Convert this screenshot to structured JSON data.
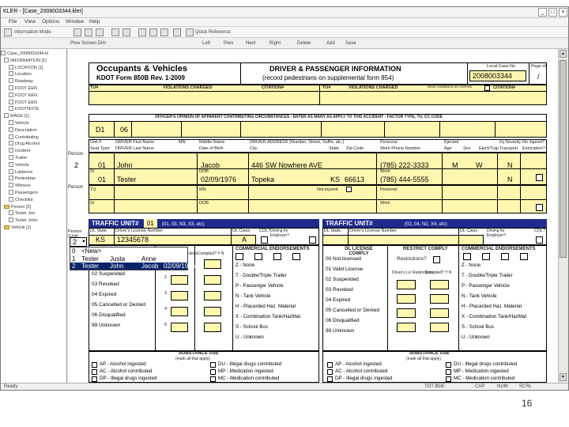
{
  "window": {
    "title": "KLER - [Case_2008003344.kler]",
    "min": "_",
    "max": "□",
    "close": "×"
  },
  "menu": [
    "File",
    "View",
    "Options",
    "Window",
    "Help"
  ],
  "toolbar1": {
    "a": "Information Mode",
    "b": "Quick Reference"
  },
  "toolbar2": {
    "a": "Prev Screen Dim",
    "b": "Left",
    "c": "Prev",
    "d": "Next",
    "e": "Right",
    "f": "Delete",
    "g": "Add",
    "h": "Save"
  },
  "tree": [
    "Case_2008003344.kl",
    "INFORMATION [1]",
    "LOCATION [1]",
    "Location",
    "Roadway",
    "FOOT EEN",
    "FOOT EEN",
    "FOOT EEN",
    "FOOTNOTE",
    "MAGE [1]",
    "Vehicle",
    "Description",
    "Contributing",
    "Drug Alcohol",
    "Incident",
    "Trailer",
    "Vehicle",
    "Lalderice",
    "Pedestrian",
    "Witness",
    "Passengers",
    "Checklist",
    "Person [2]",
    "Tester Joe",
    "Tester John",
    "Vehicle [1]"
  ],
  "form": {
    "title": "Occupants & Vehicles",
    "subtitle": "KDOT Form 850B Rev. 1-2009",
    "center_title": "DRIVER & PASSENGER INFORMATION",
    "center_sub": "(record pedestrians on supplemental form 854)",
    "case_label": "Local Case No",
    "case_no": "2008003344",
    "page_label": "Page of",
    "page_val": "/",
    "tu_label": "TU#",
    "violations_label": "VIOLATIONS CHARGED",
    "citation_label": "CITATION#",
    "tu2_label": "TU#",
    "violations2_label": "VIOLATIONS CHARGED",
    "more_viol": "More violations on reverse",
    "citation2_label": "CITATION#",
    "officer_opinion": "OFFICER'S OPINION OF APPARENT CONTRIBUTING CIRCUMSTANCES - ENTER AS MANY AS APPLY TO THIS ACCIDENT - FACTOR TYPE, TU, CC CODE",
    "d1": "D1",
    "d1_val": "06",
    "person_label": "Person",
    "hdr_unit": "Unit #",
    "hdr_seat": "Seat Type",
    "hdr_first": "DRIVER First Name",
    "hdr_last": "DRIVER Last Name",
    "hdr_mn": "MN",
    "hdr_middle": "Middle Name",
    "hdr_dob": "Date of Birth",
    "hdr_addr": "DRIVER ADDRESS (Number, Street, Suffix, etc.)",
    "hdr_city": "City",
    "hdr_state": "State",
    "hdr_zip": "Zip Code",
    "hdr_personal": "Personal",
    "hdr_phone": "Personal Phone Number",
    "hdr_work": "Work Phone Number",
    "hdr_ejected": "Ejected",
    "hdr_age": "Age",
    "hdr_sex": "Sex",
    "hdr_inj": "Inj Severity",
    "hdr_inj_type": "Eject/Trap",
    "hdr_transport": "Transport",
    "hdr_extrication": "Extrication?",
    "hdr_no_injured": "No injured?",
    "p1_num": "2",
    "p1_unit": "01",
    "p1_first": "John",
    "p1_middle": "Jacob",
    "p1_addr": "446 SW Nowhere AVE",
    "p1_phone": "(785) 222-3333",
    "p1_age": "M",
    "p1_sex": "W",
    "p1_inj": "N",
    "p1_si": "SI",
    "p1_unit2": "01",
    "p1_last": "Tester",
    "p1_dob_label": "DOB",
    "p1_dob": "02/09/1976",
    "p1_city": "Topeka",
    "p1_state": "KS",
    "p1_zip": "66613",
    "p1_work_label": "Work",
    "p1_work": "(785) 444-5555",
    "p1_w": "N",
    "p2_tu": "TU",
    "p2_mn": "MN",
    "p2_not_injured": "Not injured",
    "p2_personal": "Personal",
    "p2_si": "SI",
    "p2_dob": "DOB",
    "p2_work": "Work",
    "traffic_unit_label": "TRAFFIC UNIT#",
    "traffic_unit_val": "01",
    "traffic_unit_hint": "(01, 03, N3, X3, etc)",
    "traffic_unit2_label": "TRAFFIC UNIT#",
    "traffic_unit2_hint": "(02, 04, N2, X4, etc)",
    "person_unit": "Person (Unit)",
    "person_unit_val": "2",
    "dl_state": "DL State",
    "dl_num": "Driver's License Number",
    "dl_class": "DL Class",
    "cdl": "CDL?",
    "driving_for_employer": "Driving for Employer?",
    "dl_state_val": "KS",
    "dl_num_val": "12345678",
    "dl_class_val": "A",
    "dl_state2": "DL State",
    "dl_num2": "Driver's License Number",
    "dl_class2": "DL Class",
    "cdl2": "CDL?",
    "driving_for_employer2": "Driving for Employer?",
    "commercial_endorse": "COMMERCIAL ENDORSEMENTS",
    "dl_comply": "DL LICENSE COMPLY",
    "restrict_comply": "RESTRICT COMPLY",
    "commercial_endorse2": "COMMERCIAL ENDORSEMENTS",
    "restrictions": "Restrictions?",
    "driver_lic_restr": "Driver's Lic Restrictions",
    "complied": "Complied? Y N",
    "codes_left": [
      "01 Valid License",
      "02 Suspended",
      "03 Revoked",
      "04 Expired",
      "05 Cancelled or Denied",
      "06 Disqualified",
      "99 Unknown"
    ],
    "endorse_left": [
      "Z - None",
      "T - Double/Triple Trailer",
      "P - Passenger Vehicle",
      "N - Tank Vehicle",
      "H - Placarded Haz. Material",
      "X - Combination Tank/HazMat",
      "S - School Bus",
      "U - Unknown"
    ],
    "codes_right": [
      "00 Not licensed",
      "01 Valid License",
      "02 Suspended",
      "03 Revoked",
      "04 Expired",
      "05 Cancelled or Denied",
      "06 Disqualified",
      "99 Unknown"
    ],
    "endorse_right": [
      "Z - None",
      "T - Double/Triple Trailer",
      "P - Passenger Vehicle",
      "N - Tank Vehicle",
      "H - Placarded Haz. Material",
      "X - Combination Tank/HazMat",
      "S - School Bus",
      "U - Unknown"
    ],
    "restr_nums": [
      "1",
      "2",
      "3",
      "4",
      "5"
    ],
    "substance_use": "SUBSTANCE USE",
    "substance_sub": "(mark all that apply)",
    "subst_left": [
      "AP - Alcohol ingested",
      "AC - Alcohol contributed",
      "DP - Illegal drugs ingested"
    ],
    "subst_mid": [
      "DU - Illegal drugs contributed",
      "MP - Medication ingested",
      "MC - Medication contributed"
    ],
    "subst_right1": [
      "AP - Alcohol ingested",
      "AC - Alcohol contributed",
      "DP - Illegal drugs ingested"
    ],
    "subst_right2": [
      "DU - Illegal drugs contributed",
      "MP - Medication ingested",
      "MC - Medication contributed"
    ],
    "unit_drop": "2"
  },
  "dropdown": [
    {
      "c1": "0",
      "c2": "<New>",
      "c3": "",
      "c4": "",
      "c5": ""
    },
    {
      "c1": "1",
      "c2": "Tester",
      "c3": "Justa",
      "c4": "Anne",
      "c5": ""
    },
    {
      "c1": "2",
      "c2": "Tester",
      "c3": "John",
      "c4": "Jacob",
      "c5": "02/09/1976"
    }
  ],
  "status": {
    "left": "Ready",
    "mid": "TOT BDE",
    "right": "CAP",
    "r2": "NUM",
    "r3": "SCRL"
  },
  "page_number": "16"
}
